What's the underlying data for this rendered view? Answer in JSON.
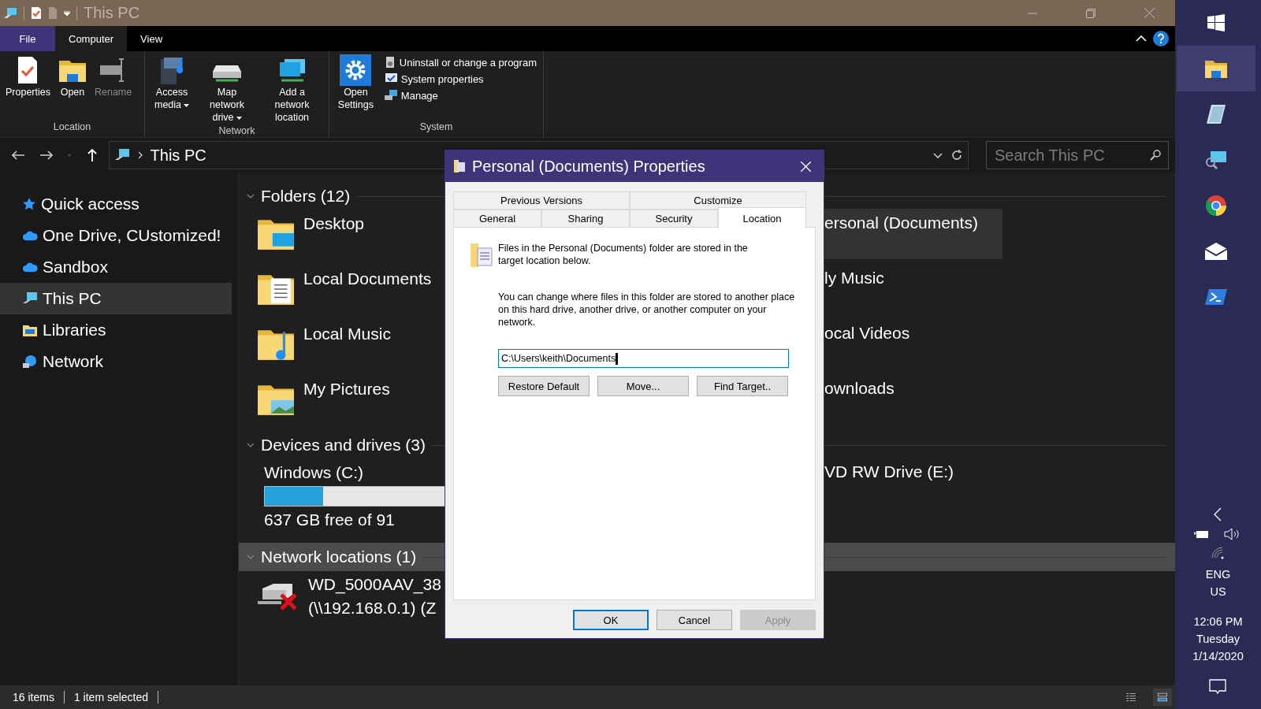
{
  "title_bar": {
    "title": "This PC",
    "controls": [
      {
        "kind": "minimize"
      },
      {
        "kind": "restore"
      },
      {
        "kind": "close"
      }
    ]
  },
  "ribbon": {
    "tabs": [
      {
        "label": "File",
        "kind": "file",
        "selected": false
      },
      {
        "label": "Computer",
        "kind": "tab",
        "selected": true
      },
      {
        "label": "View",
        "kind": "tab",
        "selected": false
      }
    ],
    "groups": [
      {
        "label": "Location",
        "commands": [
          {
            "label": "Properties",
            "kind": "properties",
            "dropdown": false,
            "disabled": false
          },
          {
            "label": "Open",
            "kind": "open",
            "dropdown": false,
            "disabled": false
          },
          {
            "label": "Rename",
            "kind": "rename",
            "dropdown": false,
            "disabled": true
          }
        ]
      },
      {
        "label": "Network",
        "commands": [
          {
            "label": "Access media",
            "kind": "media",
            "dropdown": true,
            "disabled": false
          },
          {
            "label": "Map network drive",
            "kind": "mapdrive",
            "dropdown": true,
            "disabled": false
          },
          {
            "label": "Add a network location",
            "kind": "netloc",
            "dropdown": false,
            "disabled": false
          }
        ]
      },
      {
        "label": "System",
        "commands": [
          {
            "label": "Open Settings",
            "kind": "settings",
            "dropdown": false,
            "disabled": false
          }
        ],
        "links": [
          {
            "label": "Uninstall or change a program",
            "kind": "uninstall"
          },
          {
            "label": "System properties",
            "kind": "sysprops"
          },
          {
            "label": "Manage",
            "kind": "manage"
          }
        ]
      }
    ]
  },
  "address": {
    "location": "This PC"
  },
  "search": {
    "placeholder": "Search This PC"
  },
  "sidebar": {
    "items": [
      {
        "label": "Quick access",
        "kind": "star",
        "selected": false
      },
      {
        "label": "One Drive, CUstomized!",
        "kind": "cloud",
        "selected": false
      },
      {
        "label": "Sandbox",
        "kind": "cloud",
        "selected": false
      },
      {
        "label": "This PC",
        "kind": "pc",
        "selected": true
      },
      {
        "label": "Libraries",
        "kind": "libraries",
        "selected": false
      },
      {
        "label": "Network",
        "kind": "network",
        "selected": false
      }
    ]
  },
  "content": {
    "sections": [
      {
        "title": "Folders (12)",
        "expanded": true,
        "highlighted": false,
        "rows": [
          {
            "left": {
              "label": "Desktop",
              "kind": "desktop",
              "selected": false
            },
            "right": {
              "label": "ersonal (Documents)",
              "selected": true
            }
          },
          {
            "left": {
              "label": "Local Documents",
              "kind": "documents",
              "selected": false
            },
            "right": {
              "label": "ly Music",
              "selected": false
            }
          },
          {
            "left": {
              "label": "Local Music",
              "kind": "music",
              "selected": false
            },
            "right": {
              "label": "ocal Videos",
              "selected": false
            }
          },
          {
            "left": {
              "label": "My Pictures",
              "kind": "pictures",
              "selected": false
            },
            "right": {
              "label": "ownloads",
              "selected": false
            }
          }
        ]
      },
      {
        "title": "Devices and drives (3)",
        "expanded": true,
        "highlighted": false,
        "rows": [
          {
            "left": {
              "label": "Windows (C:)",
              "kind": "drive",
              "level": 0.31,
              "detail": "637 GB free of 91",
              "selected": false
            },
            "right": {
              "label": "VD RW Drive (E:)",
              "selected": false
            }
          }
        ]
      },
      {
        "title": "Network locations (1)",
        "expanded": true,
        "highlighted": true,
        "rows": [
          {
            "left": {
              "label": "WD_5000AAV_38",
              "kind": "netdrive",
              "detail": "(\\\\192.168.0.1) (Z",
              "selected": false
            }
          }
        ]
      }
    ]
  },
  "status_bar": {
    "items": "16 items",
    "selection": "1 item selected",
    "views": [
      {
        "kind": "details",
        "selected": false
      },
      {
        "kind": "tiles",
        "selected": true
      }
    ]
  },
  "dialog": {
    "title": "Personal (Documents) Properties",
    "tab_rows": [
      [
        {
          "label": "Previous Versions",
          "selected": false
        },
        {
          "label": "Customize",
          "selected": false
        }
      ],
      [
        {
          "label": "General",
          "selected": false
        },
        {
          "label": "Sharing",
          "selected": false
        },
        {
          "label": "Security",
          "selected": false
        },
        {
          "label": "Location",
          "selected": true
        }
      ]
    ],
    "intro": "Files in the Personal (Documents) folder are stored in the target location below.",
    "description": "You can change where files in this folder are stored to another place on this hard drive, another drive, or another computer on your network.",
    "path": "C:\\Users\\keith\\Documents",
    "actions": [
      "Restore Default",
      "Move...",
      "Find Target.."
    ],
    "buttons": [
      {
        "label": "OK",
        "default": true,
        "disabled": false
      },
      {
        "label": "Cancel",
        "default": false,
        "disabled": false
      },
      {
        "label": "Apply",
        "default": false,
        "disabled": true
      }
    ]
  },
  "taskbar": {
    "apps": [
      {
        "kind": "start",
        "selected": false
      },
      {
        "kind": "explorer",
        "selected": true
      },
      {
        "kind": "notes",
        "selected": false
      },
      {
        "kind": "remote",
        "selected": false
      },
      {
        "kind": "chrome",
        "selected": false
      },
      {
        "kind": "mail",
        "selected": false
      },
      {
        "kind": "powershell",
        "selected": false
      }
    ],
    "language": [
      "ENG",
      "US"
    ],
    "time": "12:06 PM",
    "day": "Tuesday",
    "date": "1/14/2020"
  }
}
